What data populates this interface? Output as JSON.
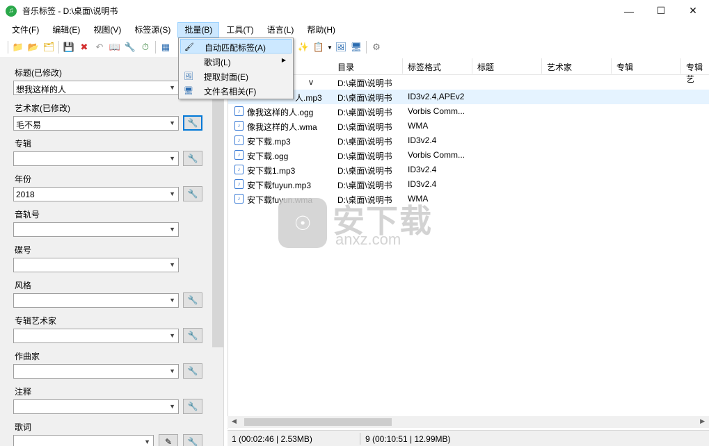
{
  "window": {
    "title": "音乐标签 - D:\\桌面\\说明书",
    "app_icon": "music-note-icon",
    "controls": [
      "minimize-icon",
      "maximize-icon",
      "close-icon"
    ]
  },
  "menubar": {
    "items": [
      {
        "label": "文件(F)"
      },
      {
        "label": "编辑(E)"
      },
      {
        "label": "视图(V)"
      },
      {
        "label": "标签源(S)"
      },
      {
        "label": "批量(B)"
      },
      {
        "label": "工具(T)"
      },
      {
        "label": "语言(L)"
      },
      {
        "label": "帮助(H)"
      }
    ],
    "active_index": 4
  },
  "batch_menu": {
    "items": [
      {
        "label": "自动匹配标签(A)",
        "icon": "magic-wand-icon"
      },
      {
        "label": "歌词(L)",
        "icon": "",
        "has_submenu": true
      },
      {
        "label": "提取封面(E)",
        "icon": "extract-cover-icon"
      },
      {
        "label": "文件名相关(F)",
        "icon": "filename-icon"
      }
    ],
    "hover_index": 0
  },
  "tag_fields": [
    {
      "label": "标题(已修改)",
      "value": "想我这样的人"
    },
    {
      "label": "艺术家(已修改)",
      "value": "毛不易"
    },
    {
      "label": "专辑",
      "value": ""
    },
    {
      "label": "年份",
      "value": "2018"
    },
    {
      "label": "音轨号",
      "value": ""
    },
    {
      "label": "碟号",
      "value": ""
    },
    {
      "label": "风格",
      "value": ""
    },
    {
      "label": "专辑艺术家",
      "value": ""
    },
    {
      "label": "作曲家",
      "value": ""
    },
    {
      "label": "注释",
      "value": ""
    },
    {
      "label": "歌词",
      "value": ""
    }
  ],
  "file_list": {
    "columns": [
      "目录",
      "标签格式",
      "标题",
      "艺术家",
      "专辑",
      "专辑艺"
    ],
    "rows": [
      {
        "name": "v",
        "dir": "D:\\桌面\\说明书",
        "format": ""
      },
      {
        "name": "人.mp3",
        "dir": "D:\\桌面\\说明书",
        "format": "ID3v2.4,APEv2"
      },
      {
        "name": "像我这样的人.ogg",
        "dir": "D:\\桌面\\说明书",
        "format": "Vorbis Comm..."
      },
      {
        "name": "像我这样的人.wma",
        "dir": "D:\\桌面\\说明书",
        "format": "WMA"
      },
      {
        "name": "安下载.mp3",
        "dir": "D:\\桌面\\说明书",
        "format": "ID3v2.4"
      },
      {
        "name": "安下载.ogg",
        "dir": "D:\\桌面\\说明书",
        "format": "Vorbis Comm..."
      },
      {
        "name": "安下载1.mp3",
        "dir": "D:\\桌面\\说明书",
        "format": "ID3v2.4"
      },
      {
        "name": "安下载fuyun.mp3",
        "dir": "D:\\桌面\\说明书",
        "format": "ID3v2.4"
      },
      {
        "name": "安下载fuyun.wma",
        "dir": "D:\\桌面\\说明书",
        "format": "WMA"
      }
    ],
    "selected_index": 1
  },
  "status": {
    "selected": "1 (00:02:46 | 2.53MB)",
    "total": "9 (00:10:51 | 12.99MB)"
  },
  "watermark": {
    "main": "安下载",
    "sub": "anxz.com"
  }
}
